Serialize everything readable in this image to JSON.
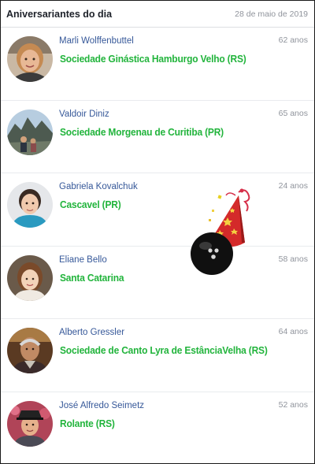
{
  "header": {
    "title": "Aniversariantes do dia",
    "date": "28 de maio de 2019"
  },
  "people": [
    {
      "name": "Marli Wolffenbuttel",
      "age": "62 anos",
      "club": "Sociedade Ginástica Hamburgo Velho (RS)"
    },
    {
      "name": "Valdoir Diniz",
      "age": "65 anos",
      "club": "Sociedade Morgenau de Curitiba (PR)"
    },
    {
      "name": "Gabriela Kovalchuk",
      "age": "24 anos",
      "club": "Cascavel (PR)"
    },
    {
      "name": "Eliane Bello",
      "age": "58 anos",
      "club": "Santa Catarina"
    },
    {
      "name": "Alberto Gressler",
      "age": "64 anos",
      "club": "Sociedade de Canto Lyra de EstânciaVelha (RS)"
    },
    {
      "name": "José Alfredo Seimetz",
      "age": "52 anos",
      "club": "Rolante (RS)"
    }
  ],
  "decoration": {
    "icon": "party-hat-bowling-ball-icon"
  }
}
